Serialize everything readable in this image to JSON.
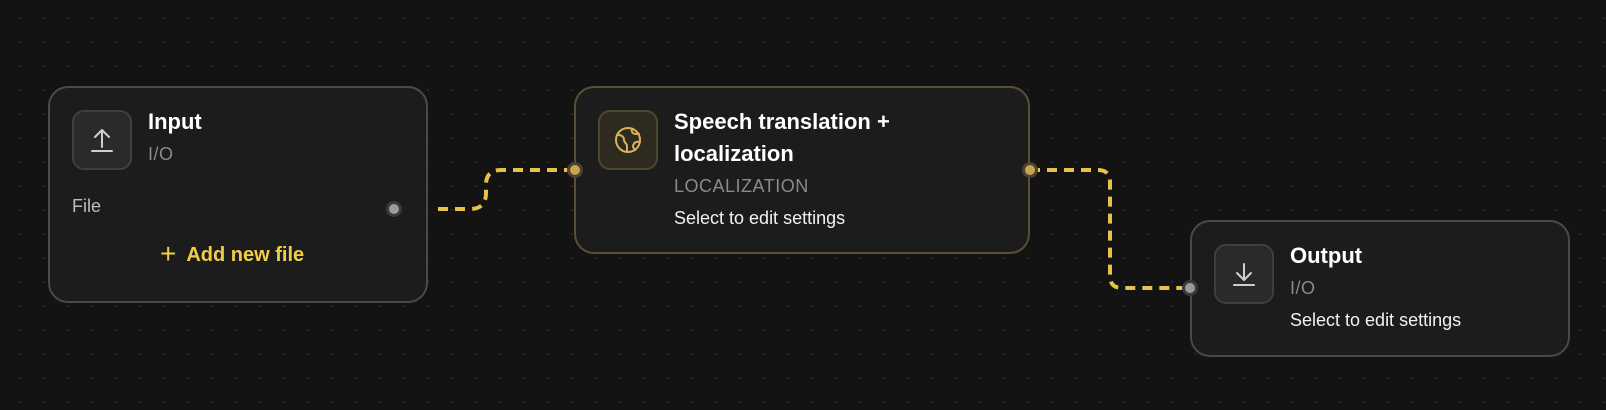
{
  "colors": {
    "background": "#131313",
    "node_bg": "#1c1c1c",
    "node_border": "#4a4a4a",
    "accent": "#f0cf47",
    "edge": "#e8c14a"
  },
  "nodes": {
    "input": {
      "title": "Input",
      "category": "I/O",
      "icon": "upload-icon",
      "port_label": "File",
      "add_label": "Add new file",
      "add_icon": "plus-icon"
    },
    "speech": {
      "title_line1": "Speech translation +",
      "title_line2": "localization",
      "category": "LOCALIZATION",
      "icon": "globe-icon",
      "hint": "Select to edit settings"
    },
    "output": {
      "title": "Output",
      "category": "I/O",
      "icon": "download-icon",
      "hint": "Select to edit settings"
    }
  }
}
